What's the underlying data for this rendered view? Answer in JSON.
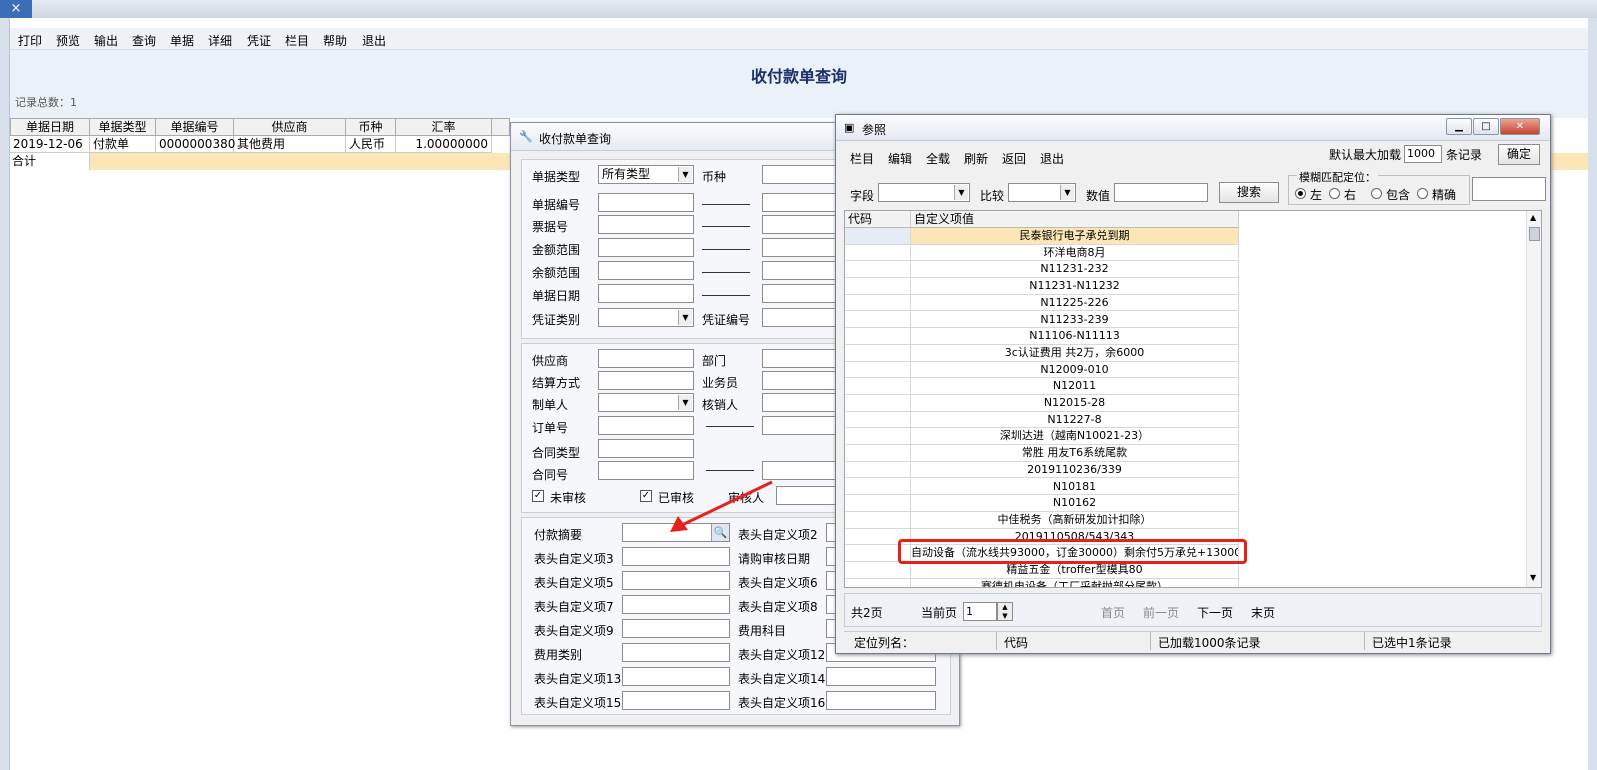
{
  "top": {
    "close_glyph": "×"
  },
  "menu": [
    "打印",
    "预览",
    "输出",
    "查询",
    "单据",
    "详细",
    "凭证",
    "栏目",
    "帮助",
    "退出"
  ],
  "page_title": "收付款单查询",
  "record_count": "记录总数：1",
  "grid": {
    "headers": [
      "单据日期",
      "单据类型",
      "单据编号",
      "供应商",
      "币种",
      "汇率"
    ],
    "row": [
      "2019-12-06",
      "付款单",
      "0000000380",
      "其他费用",
      "人民币",
      "1.00000000"
    ],
    "sum_label": "合计"
  },
  "dialog1": {
    "title": "收付款单查询",
    "fields_left": [
      "单据类型",
      "单据编号",
      "票据号",
      "金额范围",
      "余额范围",
      "单据日期",
      "凭证类别"
    ],
    "doc_type_value": "所有类型",
    "currency_label": "币种",
    "voucher_no_label": "凭证编号",
    "group2_left": [
      "供应商",
      "结算方式",
      "制单人",
      "订单号",
      "合同类型",
      "合同号"
    ],
    "group2_right": [
      "部门",
      "业务员",
      "核销人"
    ],
    "unaudited": "未审核",
    "audited": "已审核",
    "auditor": "审核人",
    "group3_left": [
      "付款摘要",
      "表头自定义项3",
      "表头自定义项5",
      "表头自定义项7",
      "表头自定义项9",
      "费用类别",
      "表头自定义项13",
      "表头自定义项15"
    ],
    "group3_right": [
      "表头自定义项2",
      "请购审核日期",
      "表头自定义项6",
      "表头自定义项8",
      "费用科目",
      "表头自定义项12",
      "表头自定义项14",
      "表头自定义项16"
    ]
  },
  "dialog2": {
    "title": "参照",
    "toolbar": [
      "栏目",
      "编辑",
      "全载",
      "刷新",
      "返回",
      "退出"
    ],
    "max_load_label": "默认最大加载",
    "max_load_value": "1000",
    "records_unit": "条记录",
    "ok_label": "确定",
    "field_label": "字段",
    "compare_label": "比较",
    "value_label": "数值",
    "search_label": "搜索",
    "fuzzy_label": "模糊匹配定位：",
    "radios": [
      "左",
      "右",
      "包含",
      "精确"
    ],
    "columns": [
      "代码",
      "自定义项值"
    ],
    "rows": [
      "民泰银行电子承兑到期",
      "环洋电商8月",
      "N11231-232",
      "N11231-N11232",
      "N11225-226",
      "N11233-239",
      "N11106-N11113",
      "3c认证费用  共2万，余6000",
      "N12009-010",
      "N12011",
      "N12015-28",
      "N11227-8",
      "深圳达进（越南N10021-23）",
      "常胜 用友T6系统尾款",
      "2019110236/339",
      "N10181",
      "N10162",
      "中佳税务（高新研发加计扣除）",
      "2019110508/543/343",
      "自动设备（流水线共93000，订金30000）剩余付5万承兑+13000",
      "精益五金（troffer型模具80",
      "赛德机电设备（工厂采献抛部分尾款）"
    ],
    "total_pages": "共2页",
    "current_page_label": "当前页",
    "current_page_value": "1",
    "nav": [
      "首页",
      "前一页",
      "下一页",
      "末页"
    ],
    "status": [
      "定位列名：",
      "代码",
      "已加载1000条记录",
      "已选中1条记录"
    ]
  },
  "colors": {
    "accent": "#3a6fb6",
    "highlight_border": "#e8201c",
    "arrow": "#e8201c",
    "selected_row": "#fde6b5"
  }
}
